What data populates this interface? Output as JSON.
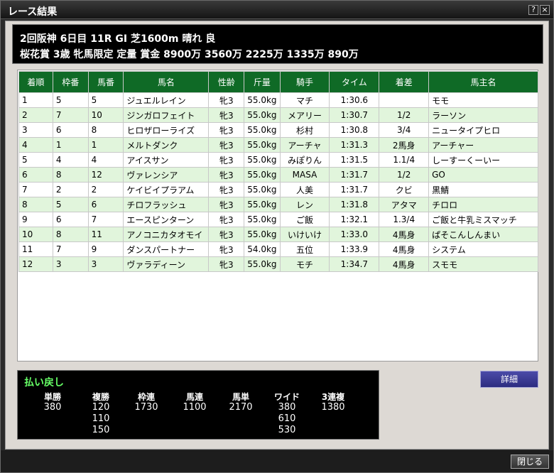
{
  "window": {
    "title": "レース結果",
    "help_label": "?",
    "close_label": "×"
  },
  "race": {
    "line1": "2回阪神  6日目  11R  GⅠ  芝1600m  晴れ  良",
    "line2": "桜花賞  3歳 牝馬限定  定量  賞金  8900万  3560万  2225万  1335万  890万"
  },
  "table": {
    "headers": [
      "着順",
      "枠番",
      "馬番",
      "馬名",
      "性齢",
      "斤量",
      "騎手",
      "タイム",
      "着差",
      "馬主名"
    ],
    "rows": [
      [
        "1",
        "5",
        "5",
        "ジュエルレイン",
        "牝3",
        "55.0kg",
        "マチ",
        "1:30.6",
        "",
        "モモ"
      ],
      [
        "2",
        "7",
        "10",
        "ジンガロフェイト",
        "牝3",
        "55.0kg",
        "メアリー",
        "1:30.7",
        "1/2",
        "ラーソン"
      ],
      [
        "3",
        "6",
        "8",
        "ヒロザローライズ",
        "牝3",
        "55.0kg",
        "杉村",
        "1:30.8",
        "3/4",
        "ニュータイプヒロ"
      ],
      [
        "4",
        "1",
        "1",
        "メルトダンク",
        "牝3",
        "55.0kg",
        "アーチャ",
        "1:31.3",
        "2馬身",
        "アーチャー"
      ],
      [
        "5",
        "4",
        "4",
        "アイスサン",
        "牝3",
        "55.0kg",
        "みぽりん",
        "1:31.5",
        "1.1/4",
        "しーすーくーいー"
      ],
      [
        "6",
        "8",
        "12",
        "ヴァレンシア",
        "牝3",
        "55.0kg",
        "MASA",
        "1:31.7",
        "1/2",
        "GO"
      ],
      [
        "7",
        "2",
        "2",
        "ケイビイプラアム",
        "牝3",
        "55.0kg",
        "人美",
        "1:31.7",
        "クビ",
        "黒鯖"
      ],
      [
        "8",
        "5",
        "6",
        "チロフラッシュ",
        "牝3",
        "55.0kg",
        "レン",
        "1:31.8",
        "アタマ",
        "チロロ"
      ],
      [
        "9",
        "6",
        "7",
        "エースピンターン",
        "牝3",
        "55.0kg",
        "ご飯",
        "1:32.1",
        "1.3/4",
        "ご飯と牛乳ミスマッチ"
      ],
      [
        "10",
        "8",
        "11",
        "アノコニカタオモイ",
        "牝3",
        "55.0kg",
        "いけいけ",
        "1:33.0",
        "4馬身",
        "ぱそこんしんまい"
      ],
      [
        "11",
        "7",
        "9",
        "ダンスパートナー",
        "牝3",
        "54.0kg",
        "五位",
        "1:33.9",
        "4馬身",
        "システム"
      ],
      [
        "12",
        "3",
        "3",
        "ヴァラディーン",
        "牝3",
        "55.0kg",
        "モチ",
        "1:34.7",
        "4馬身",
        "スモモ"
      ]
    ]
  },
  "payout": {
    "title": "払い戻し",
    "columns": [
      {
        "label": "単勝",
        "values": [
          "380"
        ]
      },
      {
        "label": "複勝",
        "values": [
          "120",
          "110",
          "150"
        ]
      },
      {
        "label": "枠連",
        "values": [
          "1730"
        ]
      },
      {
        "label": "馬連",
        "values": [
          "1100"
        ]
      },
      {
        "label": "馬単",
        "values": [
          "2170"
        ]
      },
      {
        "label": "ワイド",
        "values": [
          "380",
          "610",
          "530"
        ]
      },
      {
        "label": "3連複",
        "values": [
          "1380"
        ]
      }
    ]
  },
  "buttons": {
    "detail": "詳細",
    "close": "閉じる"
  }
}
